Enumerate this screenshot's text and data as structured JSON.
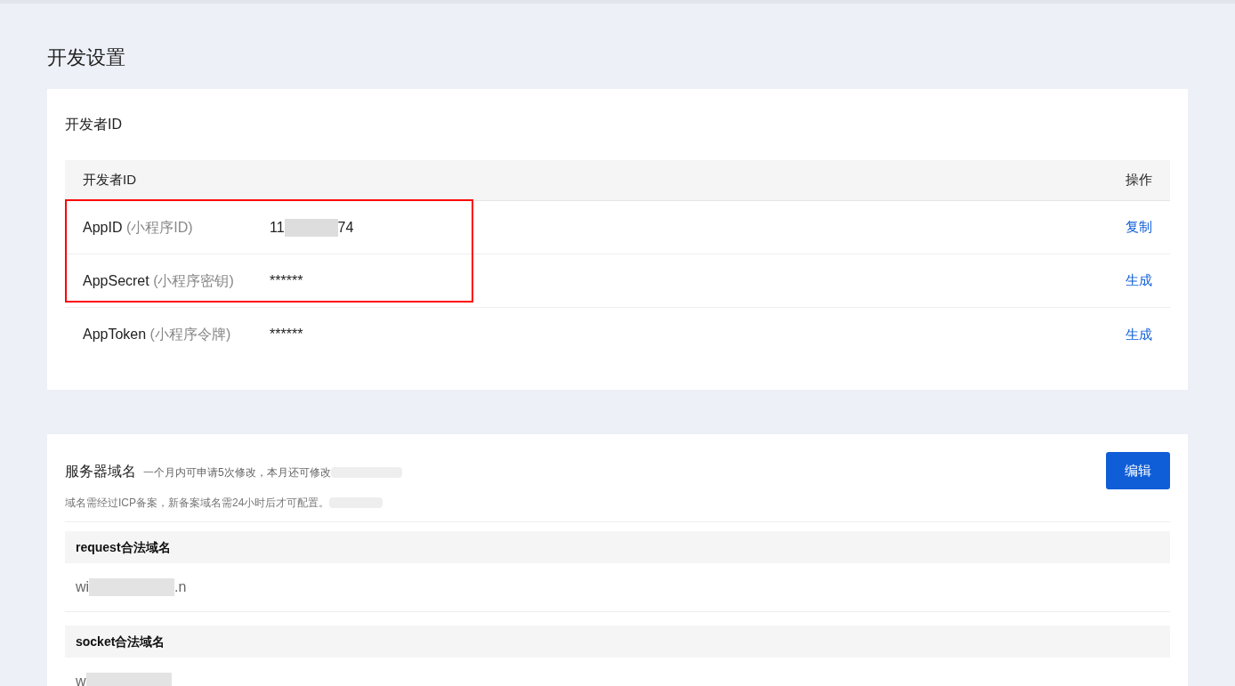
{
  "page_title": "开发设置",
  "developer_card": {
    "title": "开发者ID",
    "table": {
      "columns": [
        "开发者ID",
        "操作"
      ],
      "rows": [
        {
          "name": "AppID",
          "hint": "(小程序ID)",
          "value_start": "11",
          "value_end": "74",
          "redacted": true,
          "action": "复制",
          "highlighted": true
        },
        {
          "name": "AppSecret",
          "hint": "(小程序密钥)",
          "value_start": "******",
          "redacted": false,
          "action": "生成",
          "highlighted": true
        },
        {
          "name": "AppToken",
          "hint": "(小程序令牌)",
          "value_start": "******",
          "redacted": false,
          "action": "生成",
          "highlighted": false
        }
      ]
    }
  },
  "server_card": {
    "title": "服务器域名",
    "note": "一个月内可申请5次修改，本月还可修改",
    "sub_note": "域名需经过ICP备案，新备案域名需24小时后才可配置。",
    "button": "编辑",
    "sections": [
      {
        "heading": "request合法域名",
        "value_start": "wi",
        "value_end": ".n"
      },
      {
        "heading": "socket合法域名",
        "value_start": "w"
      }
    ]
  }
}
